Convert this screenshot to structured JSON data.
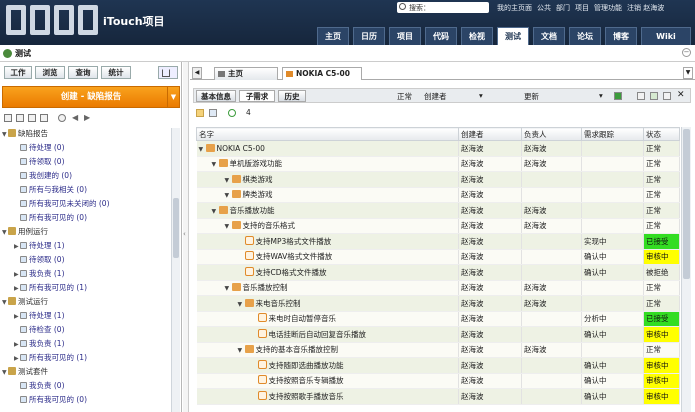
{
  "header": {
    "app_title": "iTouch项目",
    "search_placeholder": "搜索：",
    "top_links": [
      "我的主页面",
      "公共",
      "部门",
      "项目",
      "管理功能",
      "注销 赵海波"
    ],
    "tabs": [
      "主页",
      "日历",
      "项目",
      "代码",
      "检视",
      "测试",
      "文档",
      "论坛",
      "博客",
      "Wiki"
    ],
    "active_tab": "测试"
  },
  "page_title": "测试",
  "left": {
    "tabs": [
      "工作",
      "浏览",
      "查询",
      "统计"
    ],
    "create_label": "创建 - 缺陷报告",
    "tree": [
      {
        "label": "缺陷报告",
        "type": "group"
      },
      {
        "label": "待处理 (0)",
        "type": "item"
      },
      {
        "label": "待领取 (0)",
        "type": "item"
      },
      {
        "label": "我创建的 (0)",
        "type": "item"
      },
      {
        "label": "所有与我相关 (0)",
        "type": "item"
      },
      {
        "label": "所有我可见未关闭的 (0)",
        "type": "item"
      },
      {
        "label": "所有我可见的 (0)",
        "type": "item"
      },
      {
        "label": "用例运行",
        "type": "group"
      },
      {
        "label": "待处理 (1)",
        "type": "item"
      },
      {
        "label": "待领取 (0)",
        "type": "item"
      },
      {
        "label": "我负责 (1)",
        "type": "item"
      },
      {
        "label": "所有我可见的 (1)",
        "type": "item"
      },
      {
        "label": "测试运行",
        "type": "group"
      },
      {
        "label": "待处理 (1)",
        "type": "item"
      },
      {
        "label": "待检查 (0)",
        "type": "item"
      },
      {
        "label": "我负责 (1)",
        "type": "item"
      },
      {
        "label": "所有我可见的 (1)",
        "type": "item"
      },
      {
        "label": "测试套件",
        "type": "group"
      },
      {
        "label": "我负责 (0)",
        "type": "item"
      },
      {
        "label": "所有我可见的 (0)",
        "type": "item"
      }
    ]
  },
  "doc_tabs": [
    "主页",
    "NOKIA C5-00"
  ],
  "subbar": {
    "buttons": [
      "基本信息",
      "子需求",
      "历史"
    ],
    "status": "正常",
    "creator": "创建者",
    "updated": "更新"
  },
  "count": "4",
  "grid": {
    "columns": [
      "名字",
      "创建者",
      "负责人",
      "需求跟踪",
      "状态"
    ],
    "rows": [
      {
        "name": "NOKIA C5-00",
        "creator": "赵海波",
        "owner": "赵海波",
        "track": "",
        "status": "正常",
        "level": 0,
        "kind": "folder",
        "hl": ""
      },
      {
        "name": "单机版游戏功能",
        "creator": "赵海波",
        "owner": "赵海波",
        "track": "",
        "status": "正常",
        "level": 1,
        "kind": "folder",
        "hl": ""
      },
      {
        "name": "棋类游戏",
        "creator": "赵海波",
        "owner": "",
        "track": "",
        "status": "正常",
        "level": 2,
        "kind": "folder",
        "hl": ""
      },
      {
        "name": "牌类游戏",
        "creator": "赵海波",
        "owner": "",
        "track": "",
        "status": "正常",
        "level": 2,
        "kind": "folder",
        "hl": ""
      },
      {
        "name": "音乐播放功能",
        "creator": "赵海波",
        "owner": "赵海波",
        "track": "",
        "status": "正常",
        "level": 1,
        "kind": "folder",
        "hl": ""
      },
      {
        "name": "支持的音乐格式",
        "creator": "赵海波",
        "owner": "赵海波",
        "track": "",
        "status": "正常",
        "level": 2,
        "kind": "folder",
        "hl": ""
      },
      {
        "name": "支持MP3格式文件播放",
        "creator": "赵海波",
        "owner": "",
        "track": "实现中",
        "status": "已接受",
        "level": 3,
        "kind": "req",
        "hl": "green"
      },
      {
        "name": "支持WAV格式文件播放",
        "creator": "赵海波",
        "owner": "",
        "track": "确认中",
        "status": "审核中",
        "level": 3,
        "kind": "req",
        "hl": "yellow"
      },
      {
        "name": "支持CD格式文件播放",
        "creator": "赵海波",
        "owner": "",
        "track": "确认中",
        "status": "被拒绝",
        "level": 3,
        "kind": "req",
        "hl": ""
      },
      {
        "name": "音乐播放控制",
        "creator": "赵海波",
        "owner": "赵海波",
        "track": "",
        "status": "正常",
        "level": 2,
        "kind": "folder",
        "hl": ""
      },
      {
        "name": "来电音乐控制",
        "creator": "赵海波",
        "owner": "赵海波",
        "track": "",
        "status": "正常",
        "level": 3,
        "kind": "folder",
        "hl": ""
      },
      {
        "name": "来电时自动暂停音乐",
        "creator": "赵海波",
        "owner": "",
        "track": "分析中",
        "status": "已接受",
        "level": 4,
        "kind": "req",
        "hl": "green"
      },
      {
        "name": "电话挂断后自动回复音乐播放",
        "creator": "赵海波",
        "owner": "",
        "track": "确认中",
        "status": "审核中",
        "level": 4,
        "kind": "req",
        "hl": "yellow"
      },
      {
        "name": "支持的基本音乐播放控制",
        "creator": "赵海波",
        "owner": "赵海波",
        "track": "",
        "status": "正常",
        "level": 3,
        "kind": "folder",
        "hl": ""
      },
      {
        "name": "支持随即选曲播放功能",
        "creator": "赵海波",
        "owner": "",
        "track": "确认中",
        "status": "审核中",
        "level": 4,
        "kind": "req",
        "hl": "yellow"
      },
      {
        "name": "支持按照音乐专辑播放",
        "creator": "赵海波",
        "owner": "",
        "track": "确认中",
        "status": "审核中",
        "level": 4,
        "kind": "req",
        "hl": "yellow"
      },
      {
        "name": "支持按照歌手播放音乐",
        "creator": "赵海波",
        "owner": "",
        "track": "确认中",
        "status": "审核中",
        "level": 4,
        "kind": "req",
        "hl": "yellow"
      }
    ]
  }
}
